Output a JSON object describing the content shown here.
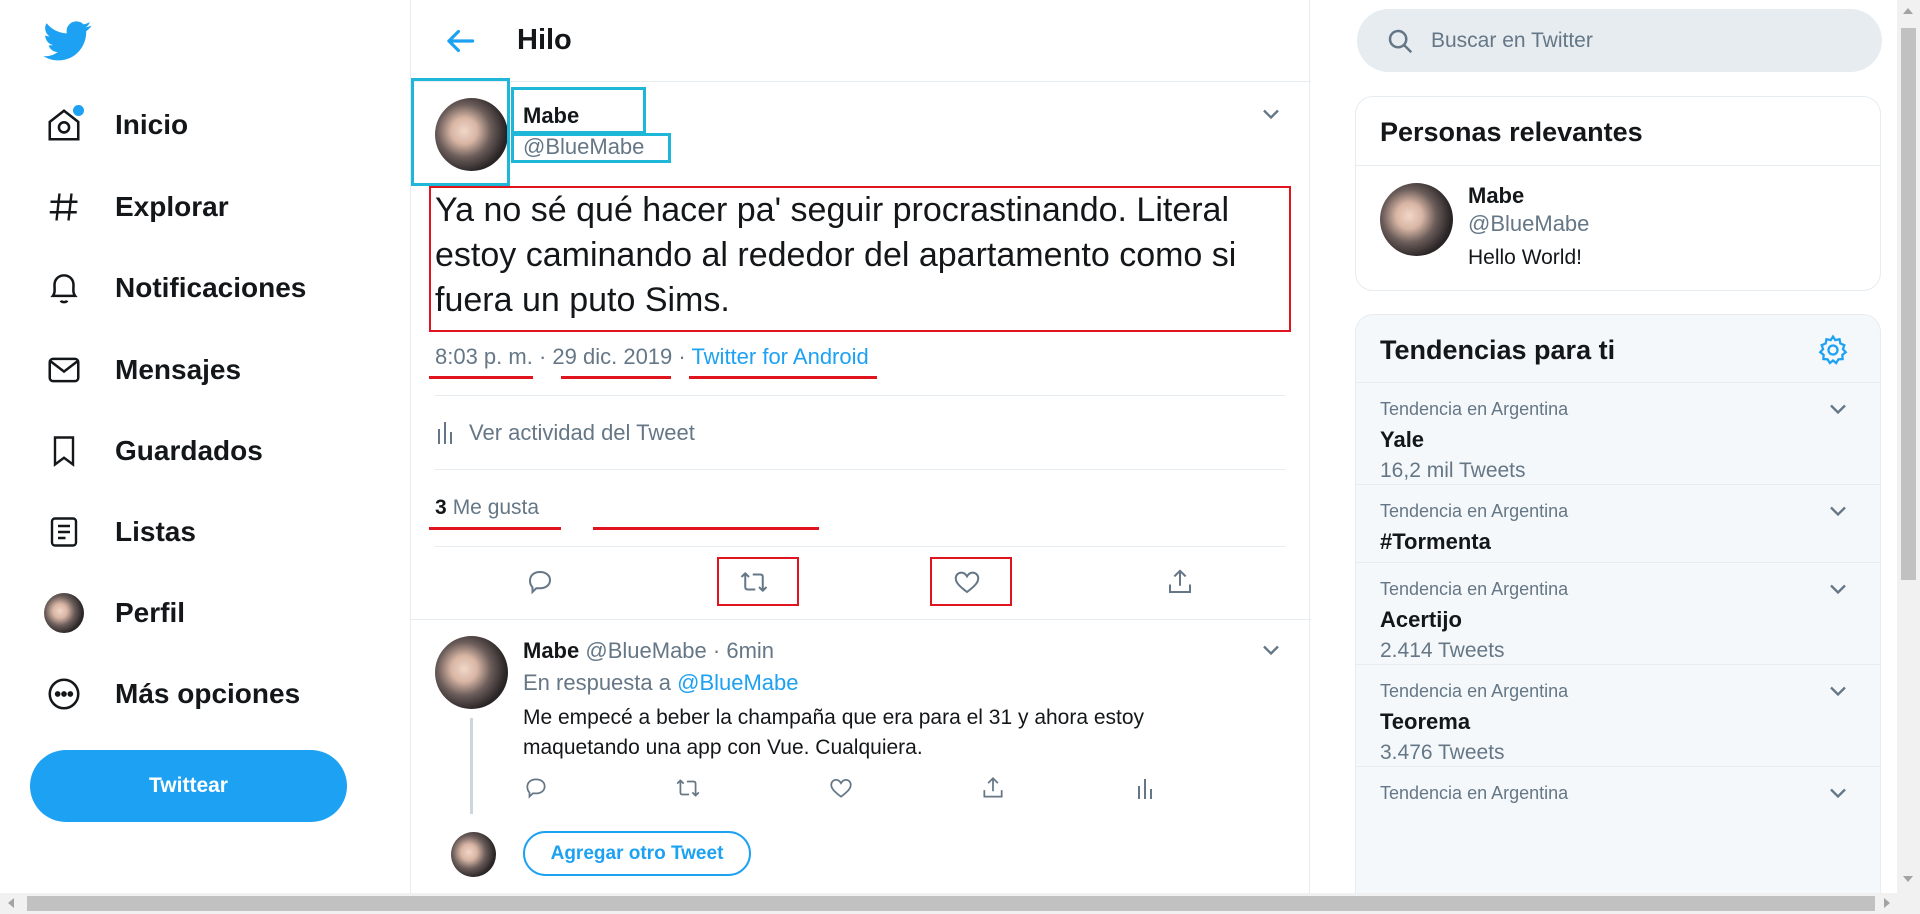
{
  "colors": {
    "brand": "#1da1f2",
    "text": "#14171a",
    "muted": "#657786",
    "border": "#e6ecf0",
    "highlight_red": "#e0141e",
    "highlight_cyan": "#1fb7d8"
  },
  "nav": {
    "items": [
      {
        "label": "Inicio",
        "icon": "home-icon"
      },
      {
        "label": "Explorar",
        "icon": "hashtag-icon"
      },
      {
        "label": "Notificaciones",
        "icon": "bell-icon"
      },
      {
        "label": "Mensajes",
        "icon": "mail-icon"
      },
      {
        "label": "Guardados",
        "icon": "bookmark-icon"
      },
      {
        "label": "Listas",
        "icon": "list-icon"
      },
      {
        "label": "Perfil",
        "icon": "avatar"
      },
      {
        "label": "Más opciones",
        "icon": "more-icon"
      }
    ],
    "tweet_button": "Twittear"
  },
  "header": {
    "title": "Hilo"
  },
  "tweet": {
    "name": "Mabe",
    "handle": "@BlueMabe",
    "text": "Ya no sé qué hacer pa' seguir procrastinando. Literal estoy caminando al rededor del apartamento como si fuera un puto Sims.",
    "time": "8:03 p. m.",
    "dot1": " · ",
    "date": "29 dic. 2019",
    "dot2": " · ",
    "source": "Twitter for Android",
    "activity": "Ver actividad del Tweet",
    "likes_count": "3",
    "likes_label": "Me gusta"
  },
  "reply": {
    "name": "Mabe",
    "handle": "@BlueMabe",
    "dot": " · ",
    "time": "6min",
    "in_reply_prefix": "En respuesta a ",
    "in_reply_handle": "@BlueMabe",
    "text": "Me empecé a beber la champaña que era para el 31 y ahora estoy maquetando una app con Vue. Cualquiera.",
    "add_button": "Agregar otro Tweet"
  },
  "search": {
    "placeholder": "Buscar en Twitter"
  },
  "relevant": {
    "title": "Personas relevantes",
    "name": "Mabe",
    "handle": "@BlueMabe",
    "bio": "Hello World!"
  },
  "trends": {
    "title": "Tendencias para ti",
    "items": [
      {
        "context": "Tendencia en Argentina",
        "name": "Yale",
        "count": "16,2 mil Tweets"
      },
      {
        "context": "Tendencia en Argentina",
        "name": "#Tormenta",
        "count": ""
      },
      {
        "context": "Tendencia en Argentina",
        "name": "Acertijo",
        "count": "2.414 Tweets"
      },
      {
        "context": "Tendencia en Argentina",
        "name": "Teorema",
        "count": "3.476 Tweets"
      },
      {
        "context": "Tendencia en Argentina",
        "name": "",
        "count": ""
      }
    ]
  }
}
